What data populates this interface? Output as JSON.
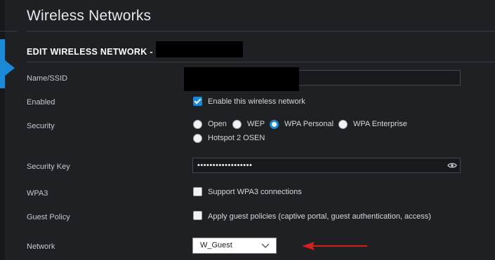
{
  "header": {
    "title": "Wireless Networks"
  },
  "form": {
    "section_title": "EDIT WIRELESS NETWORK -",
    "name_label": "Name/SSID",
    "enabled_label": "Enabled",
    "enabled_option": "Enable this wireless network",
    "enabled_checked": true,
    "security_label": "Security",
    "security_options": [
      "Open",
      "WEP",
      "WPA Personal",
      "WPA Enterprise",
      "Hotspot 2 OSEN"
    ],
    "security_selected": "WPA Personal",
    "security_key_label": "Security Key",
    "security_key_value": "••••••••••••••••••",
    "wpa3_label": "WPA3",
    "wpa3_option": "Support WPA3 connections",
    "wpa3_checked": false,
    "guest_policy_label": "Guest Policy",
    "guest_policy_option": "Apply guest policies (captive portal, guest authentication, access)",
    "guest_policy_checked": false,
    "network_label": "Network",
    "network_value": "W_Guest"
  },
  "icons": {
    "show_password": "eye-icon",
    "dropdown": "chevron-down-icon",
    "annotation": "red-arrow-icon"
  },
  "colors": {
    "background": "#1e2024",
    "accent": "#1a8ad6",
    "annotation_arrow": "#d61f1f",
    "redaction": "#000000"
  }
}
